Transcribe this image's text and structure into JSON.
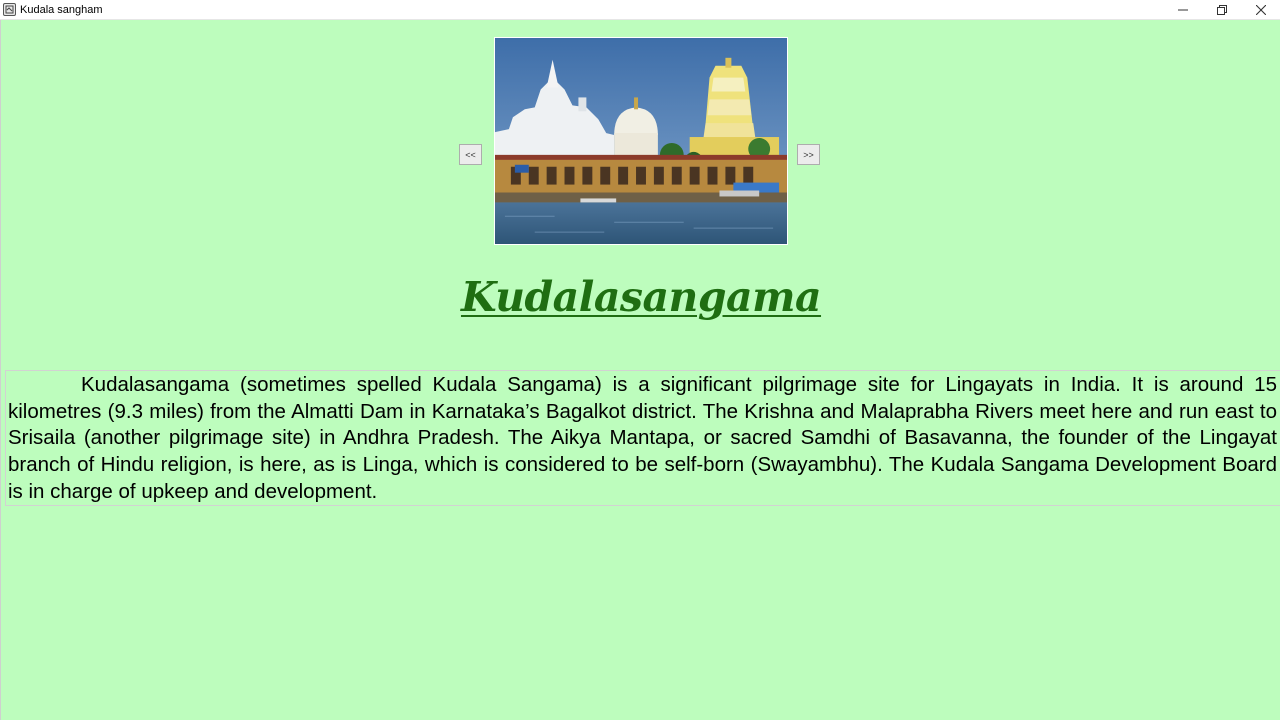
{
  "window": {
    "title": "Kudala sangham",
    "icon": "app-icon",
    "controls": [
      "minimize-icon",
      "restore-icon",
      "close-icon"
    ]
  },
  "navigation": {
    "prev_label": "<<",
    "next_label": ">>"
  },
  "photo": {
    "subject": "temple-riverfront-photo"
  },
  "heading": "Kudalasangama",
  "description": "Kudalasangama (sometimes spelled Kudala Sangama) is a significant pilgrimage site for Lingayats in India. It is around 15 kilometres (9.3 miles) from the Almatti Dam in Karnataka’s Bagalkot district. The Krishna and Malaprabha Rivers meet here and run east to Srisaila (another pilgrimage site) in Andhra Pradesh. The Aikya Mantapa, or sacred Samdhi of Basavanna, the founder of the Lingayat branch of Hindu religion, is here, as is Linga, which is considered to be self-born (Swayambhu). The Kudala Sangama Development Board is in charge of upkeep and development.",
  "colors": {
    "background": "#bdfdbd",
    "heading": "#1f6e12"
  }
}
